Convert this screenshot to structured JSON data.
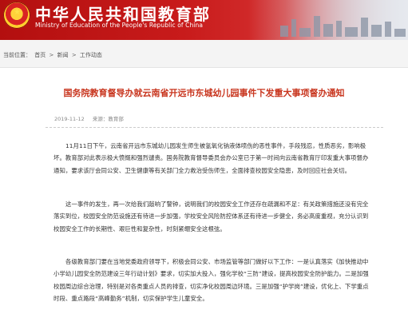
{
  "header": {
    "title": "中华人民共和国教育部",
    "subtitle": "Ministry of Education of the People's Republic of China",
    "colors": {
      "primary": "#c81b1b",
      "accent": "#ffd23a"
    }
  },
  "breadcrumb": {
    "prefix": "当前位置：",
    "items": [
      "首页",
      "新闻",
      "工作动态"
    ],
    "separator": ">"
  },
  "article": {
    "title": "国务院教育督导办就云南省开远市东城幼儿园事件下发重大事项督办通知",
    "date": "2019-11-12",
    "author": "来源：教育部",
    "title_color": "#c8351e",
    "paragraphs": [
      "11月11日下午，云南省开远市东城幼儿园发生师生被氢氧化钠液体喷伤的恶性事件，手段残忍，性质恶劣，影响极坏。教育部对此表示极大愤慨和强烈谴责。国务院教育督导委员会办公室已于第一时间向云南省教育厅印发重大事项督办通知，要求该厅会同公安、卫生健康等有关部门全力救治受伤师生，全面排查校园安全隐患，及时回应社会关切。",
      "这一事件的发生，再一次给我们敲响了警钟，说明我们的校园安全工作还存在疏漏和不足：有关政策措施还没有完全落实到位，校园安全防范设施还有待进一步加强，学校安全风险防控体系还有待进一步健全，务必高度重视，充分认识到校园安全工作的长期性、艰巨性和复杂性，时刻紧绷安全这根弦。",
      "各级教育部门要在当地党委政府领导下，积极会同公安、市场监管等部门做好以下工作：一是认真落实《加快推动中小学幼儿园安全防范建设三年行动计划》要求，切实加大投入，强化学校“三防”建设，提高校园安全防护能力。二是加强校园周边综合治理，特别是对各类重点人员的排查，切实净化校园周边环境。三是加强“护学岗”建设，优化上、下学重点时段、重点路段“高峰勤务”机制，切实保护学生儿童安全。"
    ]
  }
}
